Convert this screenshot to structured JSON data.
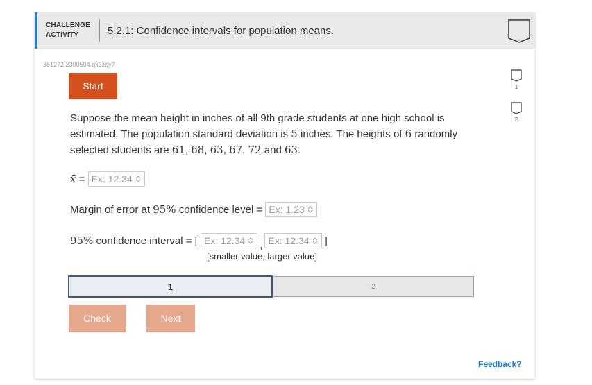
{
  "header": {
    "label_line1": "CHALLENGE",
    "label_line2": "ACTIVITY",
    "title": "5.2.1: Confidence intervals for population means."
  },
  "activity_id": "361272.2300504.qx3zqy7",
  "start_label": "Start",
  "problem": {
    "t1": "Suppose the mean height in inches of all 9th grade students at one high school is estimated. The population standard deviation is ",
    "sigma": "5",
    "t2": " inches. The heights of ",
    "n": "6",
    "t3": " randomly selected students are ",
    "h1": "61",
    "h2": "68",
    "h3": "63",
    "h4": "67",
    "h5": "72",
    "sep": ", ",
    "and": " and ",
    "h6": "63",
    "end": "."
  },
  "inputs": {
    "xbar_symbol": "x̄",
    "equals": " = ",
    "placeholder_mean": "Ex: 12.34",
    "margin_label_pre": "Margin of error at ",
    "conf_level": "95%",
    "margin_label_post": " confidence level = ",
    "placeholder_margin": "Ex: 1.23",
    "interval_label": " confidence interval = [ ",
    "placeholder_low": "Ex: 12.34",
    "comma": ",",
    "placeholder_high": "Ex: 12.34",
    "close_bracket": " ]",
    "hint": "[smaller value, larger value]"
  },
  "progress": {
    "step1": "1",
    "step2": "2"
  },
  "buttons": {
    "check": "Check",
    "next": "Next"
  },
  "feedback": "Feedback?",
  "sidebar": {
    "item1": "1",
    "item2": "2"
  },
  "colors": {
    "accent": "#2b7bc4",
    "start": "#d4501e",
    "disabled": "#e7a98e",
    "link": "#1a78c2"
  }
}
